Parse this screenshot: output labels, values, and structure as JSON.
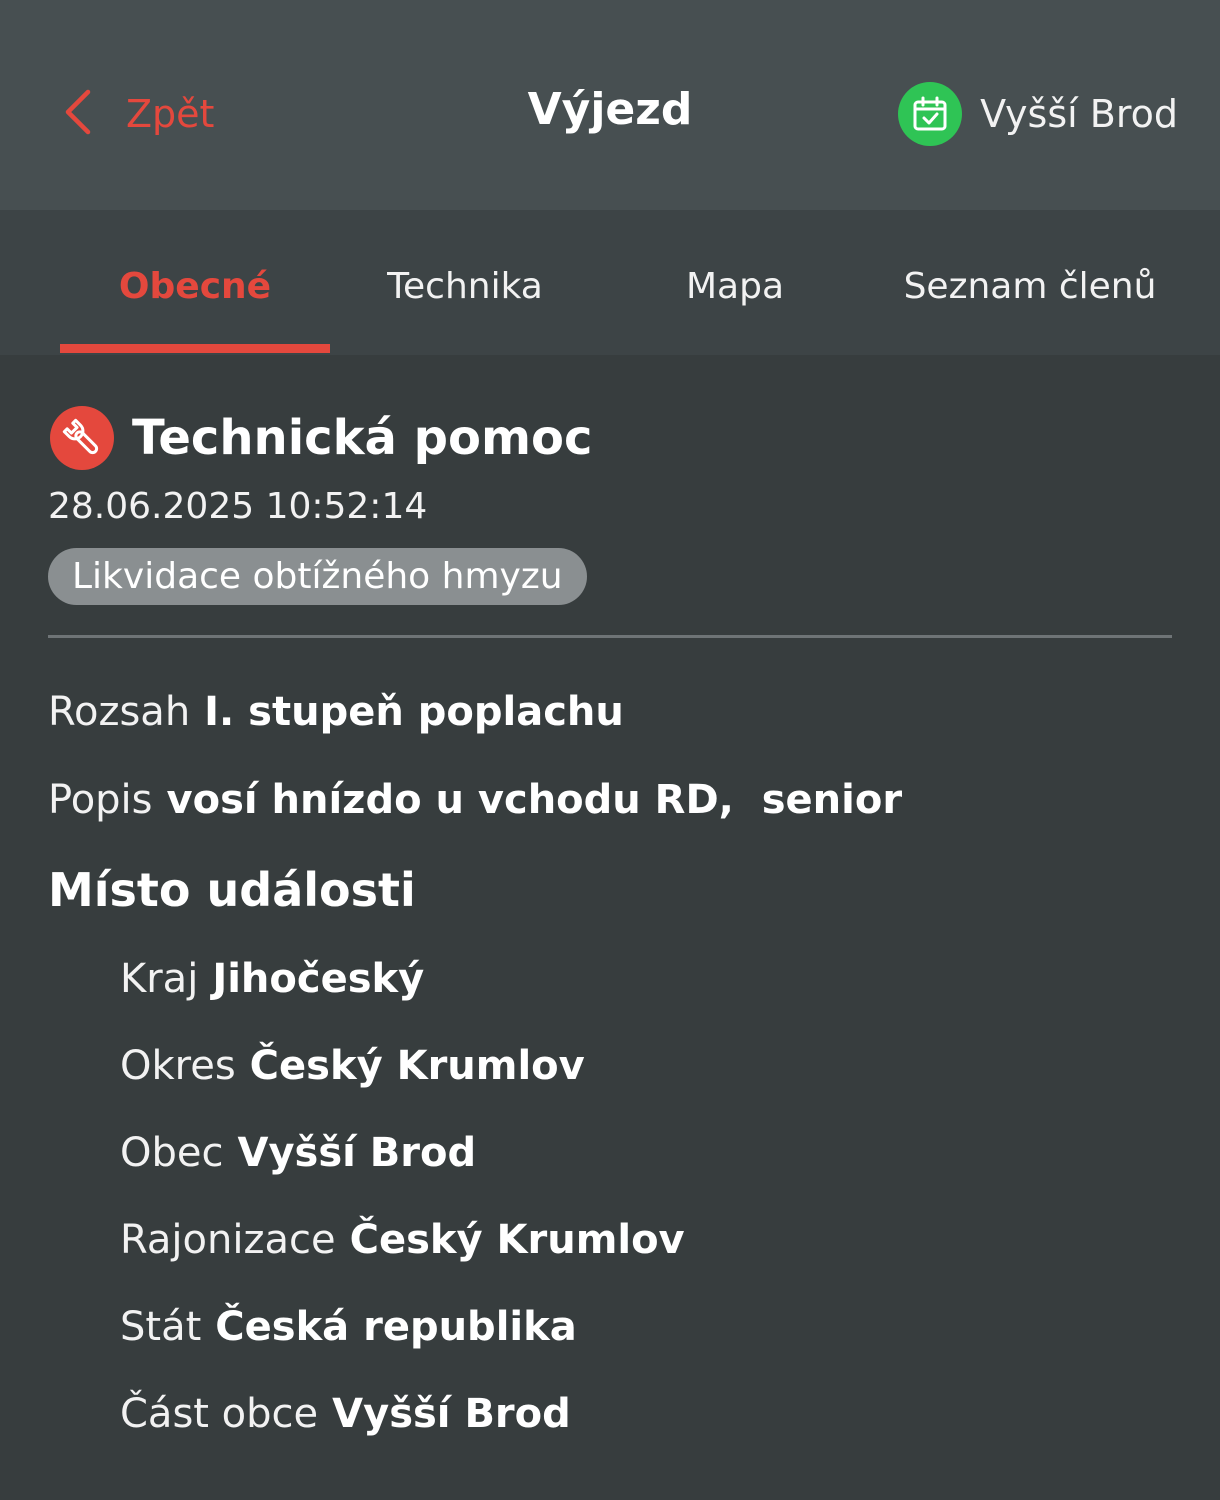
{
  "header": {
    "back_label": "Zpět",
    "title": "Výjezd",
    "station": "Vyšší Brod"
  },
  "tabs": [
    {
      "label": "Obecné",
      "active": true
    },
    {
      "label": "Technika",
      "active": false
    },
    {
      "label": "Mapa",
      "active": false
    },
    {
      "label": "Seznam členů",
      "active": false
    }
  ],
  "event": {
    "type": "Technická pomoc",
    "timestamp": "28.06.2025 10:52:14",
    "badge": "Likvidace obtížného hmyzu"
  },
  "details": {
    "rozsah_label": "Rozsah",
    "rozsah_value": "I. stupeň poplachu",
    "popis_label": "Popis",
    "popis_value": "vosí hnízdo u vchodu RD,  senior"
  },
  "location": {
    "title": "Místo události",
    "items": [
      {
        "label": "Kraj",
        "value": "Jihočeský"
      },
      {
        "label": "Okres",
        "value": "Český Krumlov"
      },
      {
        "label": "Obec",
        "value": "Vyšší Brod"
      },
      {
        "label": "Rajonizace",
        "value": "Český Krumlov"
      },
      {
        "label": "Stát",
        "value": "Česká republika"
      },
      {
        "label": "Část obce",
        "value": "Vyšší Brod"
      }
    ]
  },
  "colors": {
    "accent": "#e4483d",
    "station_badge": "#2fc455",
    "header_bg": "#474f51",
    "tabs_bg": "#3d4446",
    "content_bg": "#373d3e",
    "chip_bg": "#8a8f91"
  },
  "icons": {
    "back": "chevron-left-icon",
    "station": "calendar-check-icon",
    "event": "wrench-icon"
  }
}
